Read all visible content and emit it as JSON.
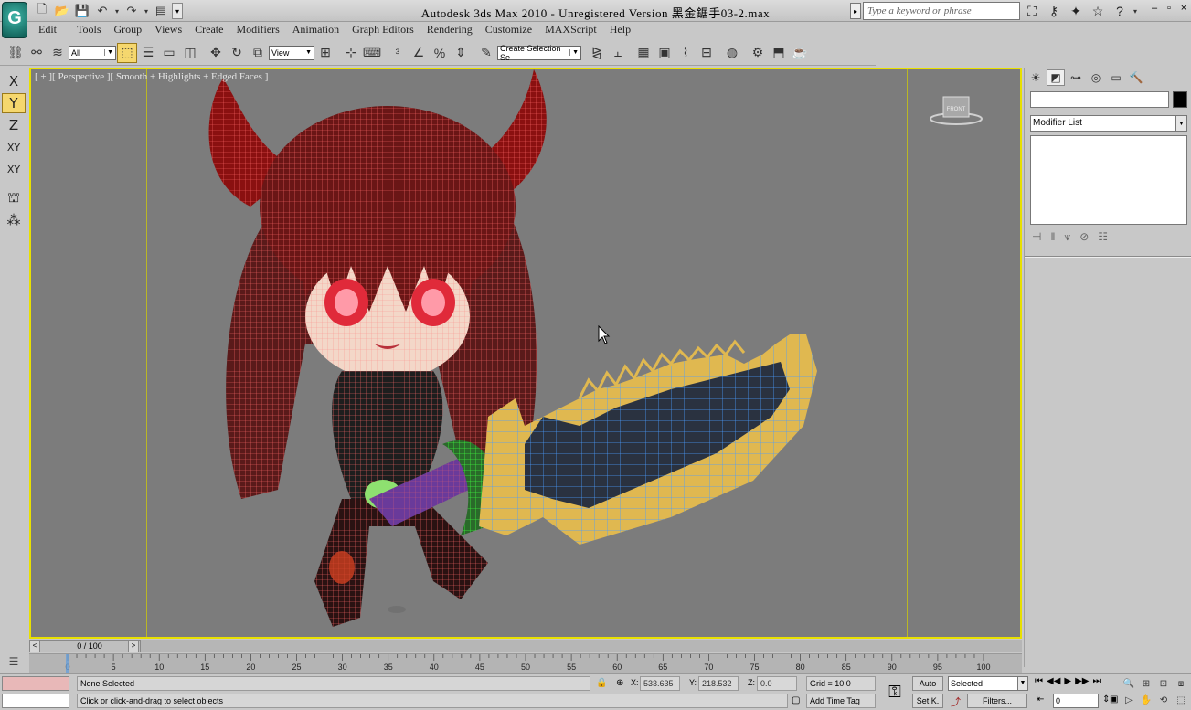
{
  "window": {
    "title": "Autodesk 3ds Max  2010   - Unregistered Version    黑金鋸手03-2.max",
    "search_placeholder": "Type a keyword or phrase",
    "controls": [
      "–",
      "▫",
      "×"
    ]
  },
  "menubar": {
    "items": [
      "Edit",
      "Tools",
      "Group",
      "Views",
      "Create",
      "Modifiers",
      "Animation",
      "Graph Editors",
      "Rendering",
      "Customize",
      "MAXScript",
      "Help"
    ]
  },
  "toolbar": {
    "selection_filter": "All",
    "ref_coord": "View",
    "named_selection_placeholder": "Create Selection Se"
  },
  "axis_toolbar": {
    "buttons": [
      "X",
      "Y",
      "Z",
      "XY",
      "XY"
    ],
    "active": "Y"
  },
  "viewport": {
    "label": "[ + ][ Perspective ][ Smooth + Highlights + Edged Faces ]",
    "viewcube_label": "FRONT"
  },
  "command_panel": {
    "modifier_list_label": "Modifier List",
    "object_color": "#000000"
  },
  "timeline": {
    "slider_label": "0 / 100",
    "ruler_ticks": [
      "0",
      "5",
      "10",
      "15",
      "20",
      "25",
      "30",
      "35",
      "40",
      "45",
      "50",
      "55",
      "60",
      "65",
      "70",
      "75",
      "80",
      "85",
      "90",
      "95",
      "100"
    ]
  },
  "statusbar": {
    "selection": "None Selected",
    "prompt": "Click or click-and-drag to select objects",
    "x_label": "X:",
    "x_value": "533.635",
    "y_label": "Y:",
    "y_value": "218.532",
    "z_label": "Z:",
    "z_value": "0.0",
    "grid": "Grid = 10.0",
    "add_time_tag": "Add Time Tag",
    "auto_key": "Auto",
    "set_key": "Set K.",
    "key_filter_selected": "Selected",
    "filters": "Filters...",
    "current_frame": "0"
  },
  "colors": {
    "viewport_bg": "#7c7c7c",
    "active_border": "#e8e000",
    "active_button": "#f5d76e",
    "maxscript_listener": "#e8b8b8"
  }
}
